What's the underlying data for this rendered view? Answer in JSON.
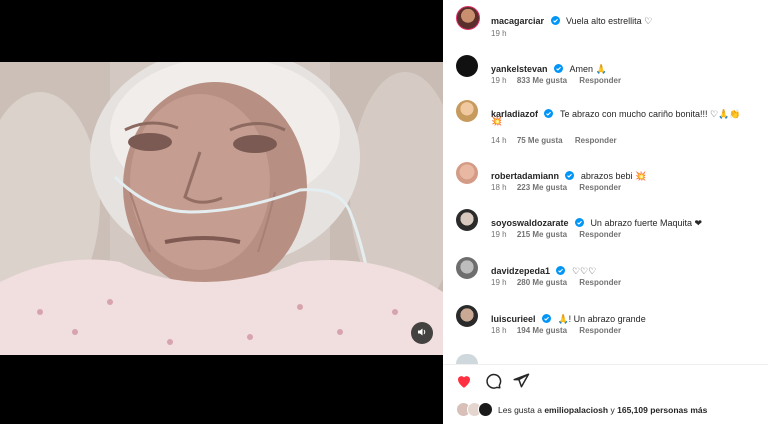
{
  "post": {
    "author": "macagarciar",
    "caption": "Vuela alto estrellita ♡",
    "time": "19 h"
  },
  "comments": [
    {
      "user": "yankelstevan",
      "text": "Amen 🙏",
      "time": "19 h",
      "likes": "833 Me gusta",
      "reply": "Responder",
      "verified": true
    },
    {
      "user": "karladiazof",
      "text": "Te abrazo con mucho cariño bonita!!! ♡🙏👏",
      "text2": "💥",
      "time": "14 h",
      "likes": "75 Me gusta",
      "reply": "Responder",
      "verified": true
    },
    {
      "user": "robertadamiann",
      "text": "abrazos bebi 💥",
      "time": "18 h",
      "likes": "223 Me gusta",
      "reply": "Responder",
      "verified": true
    },
    {
      "user": "soyoswaldozarate",
      "text": "Un abrazo fuerte Maquita ❤",
      "time": "19 h",
      "likes": "215 Me gusta",
      "reply": "Responder",
      "verified": true
    },
    {
      "user": "davidzepeda1",
      "text": "♡♡♡",
      "time": "19 h",
      "likes": "280 Me gusta",
      "reply": "Responder",
      "verified": true
    },
    {
      "user": "luiscurieel",
      "text": "🙏! Un abrazo grande",
      "time": "18 h",
      "likes": "194 Me gusta",
      "reply": "Responder",
      "verified": true
    }
  ],
  "likes_summary": {
    "prefix": "Les gusta a",
    "user": "emiliopalaciosh",
    "joiner": "y",
    "count": "165,109 personas más"
  },
  "colors": {
    "verified": "#0095f6",
    "like_red": "#ff3040",
    "heart_red": "#e0245e",
    "meta_gray": "#737373"
  },
  "icons": [
    "audio-icon",
    "heart-icon",
    "comment-icon",
    "share-icon"
  ]
}
